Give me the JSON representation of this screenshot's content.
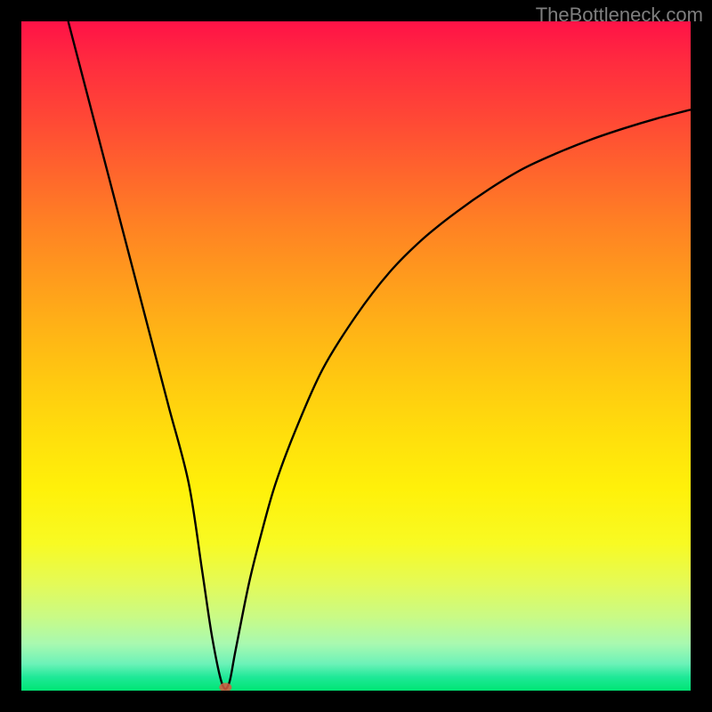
{
  "watermark": "TheBottleneck.com",
  "chart_data": {
    "type": "line",
    "title": "",
    "xlabel": "",
    "ylabel": "",
    "xlim": [
      0,
      100
    ],
    "ylim": [
      0,
      100
    ],
    "grid": false,
    "legend": false,
    "background": "red-yellow-green vertical gradient (heatmap-style)",
    "series": [
      {
        "name": "bottleneck-curve",
        "color": "#000000",
        "x": [
          7,
          10,
          13,
          16,
          19,
          22,
          25,
          27,
          28.5,
          30,
          31,
          32,
          34,
          36,
          38,
          41,
          45,
          50,
          55,
          60,
          65,
          70,
          75,
          80,
          85,
          90,
          95,
          100
        ],
        "y": [
          100,
          88.5,
          77,
          65.5,
          54,
          42.5,
          31,
          18,
          8,
          1,
          1,
          6,
          16,
          24,
          31,
          39,
          48,
          56,
          62.5,
          67.5,
          71.5,
          75,
          78,
          80.3,
          82.3,
          84,
          85.5,
          86.8
        ]
      }
    ],
    "annotations": [
      {
        "type": "point",
        "name": "minimum-marker",
        "x": 30.5,
        "y": 0.5,
        "color": "#d65a3f"
      }
    ]
  }
}
